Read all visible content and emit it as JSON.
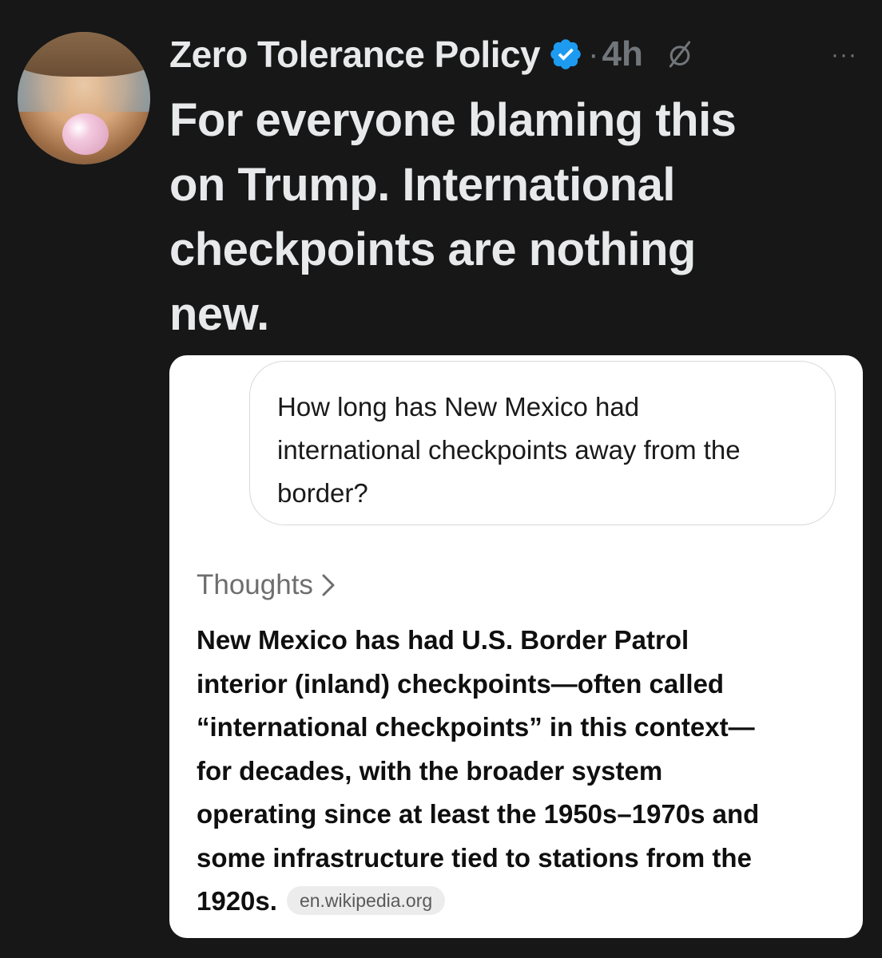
{
  "post": {
    "author_name": "Zero Tolerance Policy",
    "separator": "·",
    "time": "4h",
    "more_label": "···",
    "text_lines": [
      "For everyone blaming this",
      "on Trump. International",
      "checkpoints are nothing",
      "new."
    ]
  },
  "card": {
    "question_lines": [
      "How long has New Mexico had",
      "international checkpoints away from the",
      "border?"
    ],
    "thoughts_label": "Thoughts",
    "answer_lines": [
      "New Mexico has had U.S. Border Patrol",
      "interior (inland) checkpoints—often called",
      "“international checkpoints” in this context—",
      "for decades, with the broader system",
      "operating since at least the 1950s–1970s and",
      "some infrastructure tied to stations from the",
      "1920s."
    ],
    "source_pill": "en.wikipedia.org"
  },
  "icons": {
    "verified": "verified-badge-icon",
    "grok": "grok-icon",
    "more": "more-options-icon",
    "chevron": "chevron-right-icon"
  },
  "colors": {
    "background": "#171717",
    "verified_blue": "#1d9bf0",
    "text_primary": "#e7e9ea",
    "text_secondary": "#71767b",
    "card_bg": "#ffffff"
  }
}
